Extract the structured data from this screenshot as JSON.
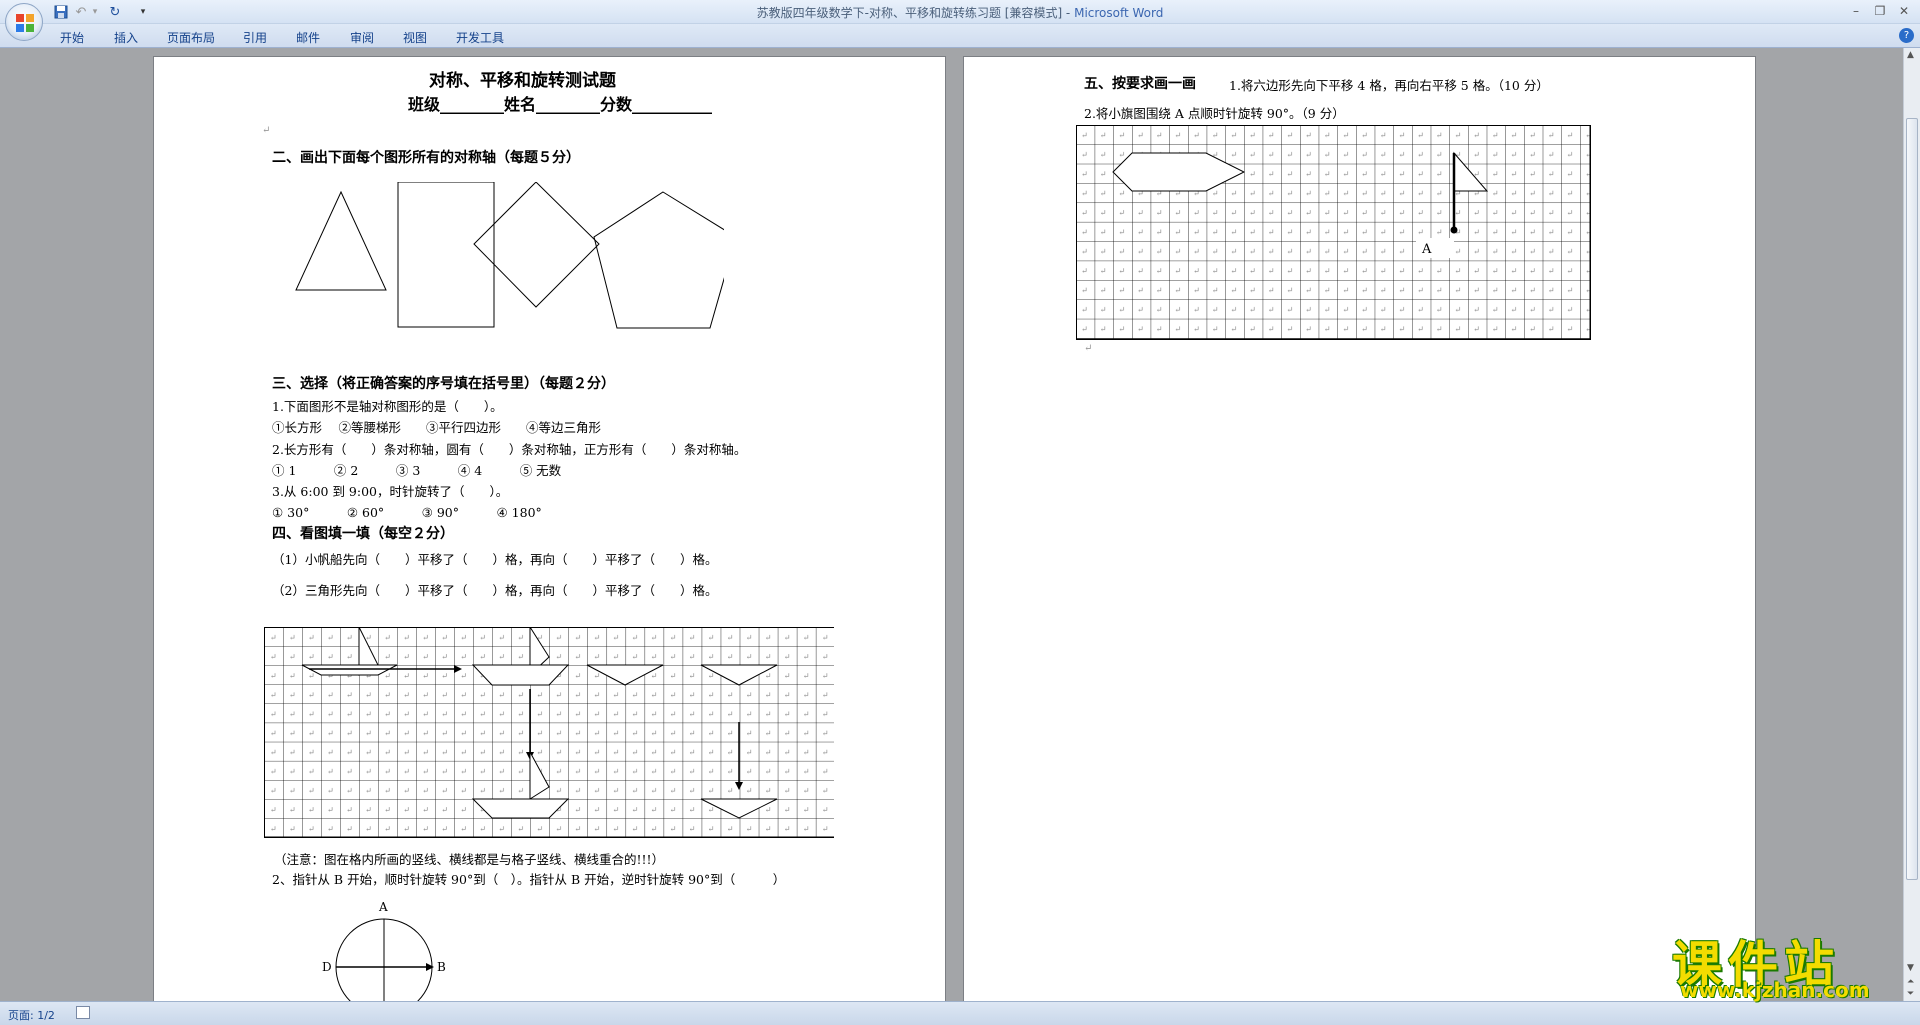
{
  "titlebar": {
    "doc_title": "苏教版四年级数学下-对称、平移和旋转练习题 [兼容模式] - ",
    "app_name": "Microsoft Word"
  },
  "ribbon": {
    "tabs": [
      "开始",
      "插入",
      "页面布局",
      "引用",
      "邮件",
      "审阅",
      "视图",
      "开发工具"
    ]
  },
  "page1": {
    "title": "对称、平移和旋转测试题",
    "header_fields": "班级________姓名________分数__________",
    "section2": "二、画出下面每个图形所有的对称轴（每题５分）",
    "section3": "三、选择（将正确答案的序号填在括号里）（每题２分）",
    "q3_1": "1.下面图形不是轴对称图形的是（　　）。",
    "q3_1_opts": "①长方形　 ②等腰梯形　　③平行四边形　　④等边三角形",
    "q3_2": "2.长方形有（　　）条对称轴，圆有（　　）条对称轴，正方形有（　　）条对称轴。",
    "q3_2_opts": "① 1　　　② 2　　　③ 3　　　④ 4　　　⑤ 无数",
    "q3_3": "3.从 6:00 到 9:00，时针旋转了（　　）。",
    "q3_3_opts": "① 30°　　　② 60°　　　③ 90°　　　④ 180°",
    "section4": "四、看图填一填（每空２分）",
    "q4_1": "（1）小帆船先向（　　）平移了（　　）格，再向（　　）平移了（　　）格。",
    "q4_2": "（2）三角形先向（　　）平移了（　　）格，再向（　　）平移了（　　）格。",
    "note": "（注意：图在格内所画的竖线、横线都是与格子竖线、横线重合的!!!）",
    "q5": "2、指针从 B 开始，顺时针旋转 90°到（　）。指针从 B 开始，逆时针旋转 90°到（　　　）",
    "dial_labels": {
      "a": "A",
      "b": "B",
      "d": "D"
    }
  },
  "page2": {
    "section5": "五、按要求画一画",
    "q5_1": "1.将六边形先向下平移 4 格，再向右平移 5 格。（10 分）",
    "q5_2": "2.将小旗图围绕 A 点顺时针旋转 90°。（9 分）",
    "point_label": "A"
  },
  "status": {
    "page": "页面: 1/2"
  },
  "watermark": {
    "main": "课件站",
    "url": "www.kjzhan.com"
  },
  "colors": {
    "title_blue": "#3b66b0",
    "ribbon_text": "#15428b",
    "watermark_yellow": "#f3dc00",
    "watermark_green": "#1a7a00"
  }
}
